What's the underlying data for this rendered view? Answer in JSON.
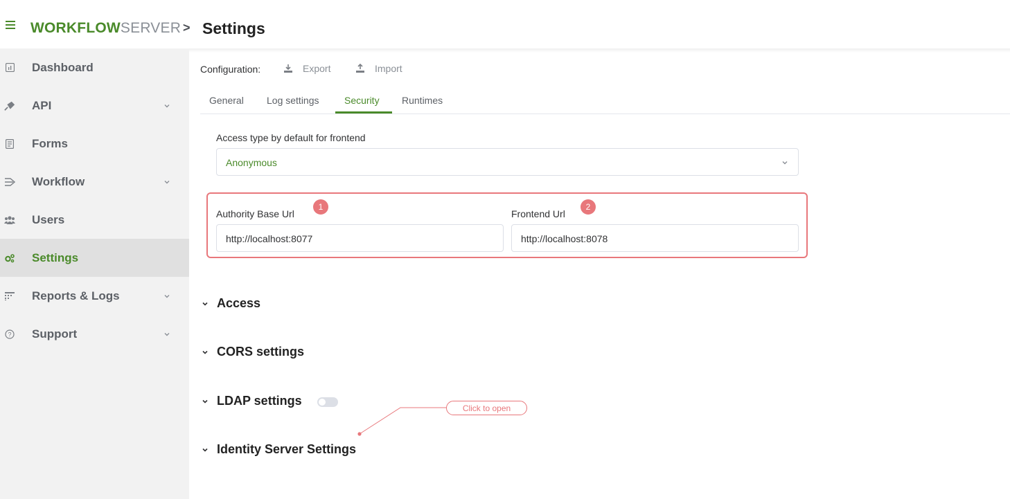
{
  "header": {
    "logo_primary": "WORKFLOW",
    "logo_secondary": "SERVER",
    "crumb_separator": ">",
    "page_title": "Settings"
  },
  "sidebar": {
    "items": [
      {
        "label": "Dashboard",
        "icon": "dashboard-icon",
        "has_submenu": false,
        "active": false
      },
      {
        "label": "API",
        "icon": "plug-icon",
        "has_submenu": true,
        "active": false
      },
      {
        "label": "Forms",
        "icon": "form-icon",
        "has_submenu": false,
        "active": false
      },
      {
        "label": "Workflow",
        "icon": "workflow-icon",
        "has_submenu": true,
        "active": false
      },
      {
        "label": "Users",
        "icon": "users-icon",
        "has_submenu": false,
        "active": false
      },
      {
        "label": "Settings",
        "icon": "cogs-icon",
        "has_submenu": false,
        "active": true
      },
      {
        "label": "Reports & Logs",
        "icon": "reports-icon",
        "has_submenu": true,
        "active": false
      },
      {
        "label": "Support",
        "icon": "help-icon",
        "has_submenu": true,
        "active": false
      }
    ]
  },
  "toolbar": {
    "config_label": "Configuration:",
    "export_label": "Export",
    "import_label": "Import"
  },
  "tabs": [
    {
      "label": "General",
      "active": false
    },
    {
      "label": "Log settings",
      "active": false
    },
    {
      "label": "Security",
      "active": true
    },
    {
      "label": "Runtimes",
      "active": false
    }
  ],
  "security": {
    "access_type_label": "Access type by default for frontend",
    "access_type_value": "Anonymous",
    "authority_url_label": "Authority Base Url",
    "authority_url_value": "http://localhost:8077",
    "frontend_url_label": "Frontend Url",
    "frontend_url_value": "http://localhost:8078",
    "badge_1": "1",
    "badge_2": "2"
  },
  "sections": [
    {
      "title": "Access"
    },
    {
      "title": "CORS settings"
    },
    {
      "title": "LDAP settings",
      "toggle_on": false
    },
    {
      "title": "Identity Server Settings"
    }
  ],
  "annotation": {
    "callout_text": "Click to open"
  },
  "colors": {
    "accent": "#4a8a2a",
    "annotation": "#e8777b",
    "sidebar_bg": "#f2f2f2"
  }
}
